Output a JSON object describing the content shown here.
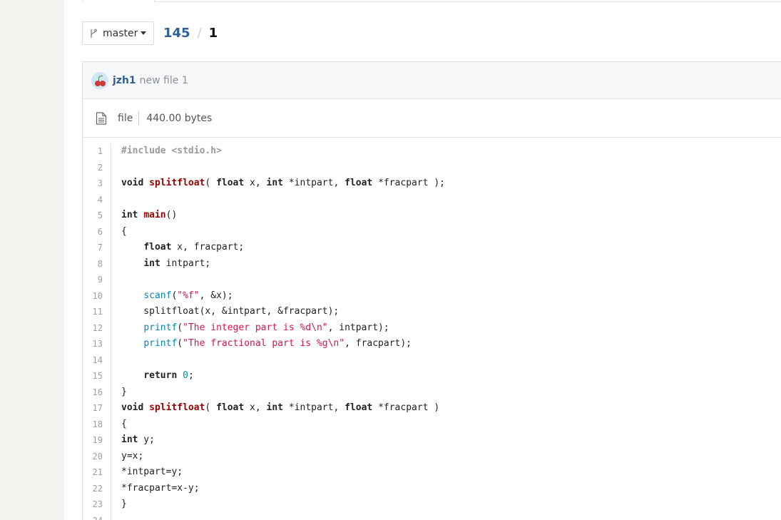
{
  "branch": {
    "label": "master"
  },
  "breadcrumb": {
    "repo": "145",
    "separator": "/",
    "path": "1"
  },
  "commit": {
    "author": "jzh1",
    "message": "new file 1"
  },
  "file": {
    "type_label": "file",
    "size": "440.00 bytes"
  },
  "code": {
    "lines": [
      {
        "n": "1",
        "parts": [
          {
            "t": "#include <stdio.h>",
            "c": "pp"
          }
        ]
      },
      {
        "n": "2",
        "parts": []
      },
      {
        "n": "3",
        "parts": [
          {
            "t": "void",
            "c": "kw"
          },
          {
            "t": " ",
            "c": ""
          },
          {
            "t": "splitfloat",
            "c": "fn"
          },
          {
            "t": "( ",
            "c": ""
          },
          {
            "t": "float",
            "c": "kw"
          },
          {
            "t": " x, ",
            "c": ""
          },
          {
            "t": "int",
            "c": "kw"
          },
          {
            "t": " *intpart, ",
            "c": ""
          },
          {
            "t": "float",
            "c": "kw"
          },
          {
            "t": " *fracpart );",
            "c": ""
          }
        ]
      },
      {
        "n": "4",
        "parts": []
      },
      {
        "n": "5",
        "parts": [
          {
            "t": "int",
            "c": "kw"
          },
          {
            "t": " ",
            "c": ""
          },
          {
            "t": "main",
            "c": "fn"
          },
          {
            "t": "()",
            "c": ""
          }
        ]
      },
      {
        "n": "6",
        "parts": [
          {
            "t": "{",
            "c": ""
          }
        ]
      },
      {
        "n": "7",
        "parts": [
          {
            "t": "    ",
            "c": ""
          },
          {
            "t": "float",
            "c": "kw"
          },
          {
            "t": " x, fracpart;",
            "c": ""
          }
        ]
      },
      {
        "n": "8",
        "parts": [
          {
            "t": "    ",
            "c": ""
          },
          {
            "t": "int",
            "c": "kw"
          },
          {
            "t": " intpart;",
            "c": ""
          }
        ]
      },
      {
        "n": "9",
        "parts": []
      },
      {
        "n": "10",
        "parts": [
          {
            "t": "    ",
            "c": ""
          },
          {
            "t": "scanf",
            "c": "lib"
          },
          {
            "t": "(",
            "c": ""
          },
          {
            "t": "\"%f\"",
            "c": "str"
          },
          {
            "t": ", &x);",
            "c": ""
          }
        ]
      },
      {
        "n": "11",
        "parts": [
          {
            "t": "    splitfloat(x, &intpart, &fracpart);",
            "c": ""
          }
        ]
      },
      {
        "n": "12",
        "parts": [
          {
            "t": "    ",
            "c": ""
          },
          {
            "t": "printf",
            "c": "lib"
          },
          {
            "t": "(",
            "c": ""
          },
          {
            "t": "\"The integer part is %d\\n\"",
            "c": "str"
          },
          {
            "t": ", intpart);",
            "c": ""
          }
        ]
      },
      {
        "n": "13",
        "parts": [
          {
            "t": "    ",
            "c": ""
          },
          {
            "t": "printf",
            "c": "lib"
          },
          {
            "t": "(",
            "c": ""
          },
          {
            "t": "\"The fractional part is %g\\n\"",
            "c": "str"
          },
          {
            "t": ", fracpart);",
            "c": ""
          }
        ]
      },
      {
        "n": "14",
        "parts": []
      },
      {
        "n": "15",
        "parts": [
          {
            "t": "    ",
            "c": ""
          },
          {
            "t": "return",
            "c": "kw"
          },
          {
            "t": " ",
            "c": ""
          },
          {
            "t": "0",
            "c": "num"
          },
          {
            "t": ";",
            "c": ""
          }
        ]
      },
      {
        "n": "16",
        "parts": [
          {
            "t": "}",
            "c": ""
          }
        ]
      },
      {
        "n": "17",
        "parts": [
          {
            "t": "void",
            "c": "kw"
          },
          {
            "t": " ",
            "c": ""
          },
          {
            "t": "splitfloat",
            "c": "fn"
          },
          {
            "t": "( ",
            "c": ""
          },
          {
            "t": "float",
            "c": "kw"
          },
          {
            "t": " x, ",
            "c": ""
          },
          {
            "t": "int",
            "c": "kw"
          },
          {
            "t": " *intpart, ",
            "c": ""
          },
          {
            "t": "float",
            "c": "kw"
          },
          {
            "t": " *fracpart )",
            "c": ""
          }
        ]
      },
      {
        "n": "18",
        "parts": [
          {
            "t": "{",
            "c": ""
          }
        ]
      },
      {
        "n": "19",
        "parts": [
          {
            "t": "int",
            "c": "kw"
          },
          {
            "t": " y;",
            "c": ""
          }
        ]
      },
      {
        "n": "20",
        "parts": [
          {
            "t": "y=x;",
            "c": ""
          }
        ]
      },
      {
        "n": "21",
        "parts": [
          {
            "t": "*intpart=y;",
            "c": ""
          }
        ]
      },
      {
        "n": "22",
        "parts": [
          {
            "t": "*fracpart=x-y;",
            "c": ""
          }
        ]
      },
      {
        "n": "23",
        "parts": [
          {
            "t": "}",
            "c": ""
          }
        ]
      },
      {
        "n": "24",
        "parts": []
      }
    ]
  }
}
